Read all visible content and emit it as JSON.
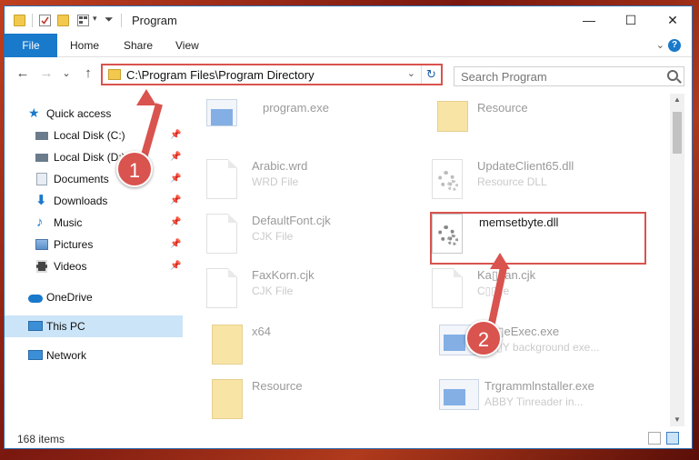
{
  "window": {
    "title": "Program",
    "minimize": "—",
    "maximize": "☐",
    "close": "✕"
  },
  "ribbon": {
    "tabs": [
      "File",
      "Home",
      "Share",
      "View"
    ],
    "collapse": "⌄",
    "help": "?"
  },
  "nav": {
    "back": "←",
    "forward": "→",
    "recent": "⌄",
    "up": "↑",
    "address": "C:\\Program Files\\Program Directory",
    "address_dropdown": "⌄",
    "refresh": "↻",
    "search_placeholder": "Search Program"
  },
  "sidebar": {
    "items": [
      {
        "label": "Quick access",
        "icon": "star-icon",
        "color": "#1979ca",
        "pinned": false
      },
      {
        "label": "Local Disk (C:)",
        "icon": "drive-icon",
        "color": "#6b7b8c",
        "pinned": true
      },
      {
        "label": "Local Disk (D:)",
        "icon": "drive-icon",
        "color": "#6b7b8c",
        "pinned": true
      },
      {
        "label": "Documents",
        "icon": "documents-icon",
        "color": "#9aa7b5",
        "pinned": true
      },
      {
        "label": "Downloads",
        "icon": "downloads-icon",
        "color": "#1979ca",
        "pinned": true
      },
      {
        "label": "Music",
        "icon": "music-icon",
        "color": "#1979ca",
        "pinned": true
      },
      {
        "label": "Pictures",
        "icon": "pictures-icon",
        "color": "#5b8fc7",
        "pinned": true
      },
      {
        "label": "Videos",
        "icon": "videos-icon",
        "color": "#444",
        "pinned": true
      },
      {
        "label": "OneDrive",
        "icon": "cloud-icon",
        "color": "#1979ca",
        "pinned": false
      },
      {
        "label": "This PC",
        "icon": "computer-icon",
        "color": "#3b8fd6",
        "pinned": false
      },
      {
        "label": "Network",
        "icon": "network-icon",
        "color": "#3b8fd6",
        "pinned": false
      }
    ],
    "pin_glyph": "📌"
  },
  "files": [
    {
      "name": "program.exe",
      "type": "",
      "icon": "exe"
    },
    {
      "name": "Resource",
      "type": "",
      "icon": "folder"
    },
    {
      "name": "Arabic.wrd",
      "type": "WRD File",
      "icon": "doc"
    },
    {
      "name": "UpdateClient65.dll",
      "type": "Resource DLL",
      "icon": "dll"
    },
    {
      "name": "DefaultFont.cjk",
      "type": "CJK File",
      "icon": "doc"
    },
    {
      "name": "memsetbyte.dll",
      "type": "",
      "icon": "dll"
    },
    {
      "name": "FaxKorn.cjk",
      "type": "CJK File",
      "icon": "doc"
    },
    {
      "name": "Ka▯▯an.cjk",
      "type": "C▯▯▯e",
      "icon": "doc"
    },
    {
      "name": "x64",
      "type": "",
      "icon": "folder"
    },
    {
      "name": "▯▯▯eExec.exe",
      "type": "▯▯▯Y background exe...",
      "icon": "exe"
    },
    {
      "name": "Resource",
      "type": "",
      "icon": "folder"
    },
    {
      "name": "Trgrammlnstaller.exe",
      "type": "ABBY Tinreader in...",
      "icon": "exe"
    }
  ],
  "status": {
    "items_count": "168 items"
  },
  "callouts": [
    "1",
    "2"
  ]
}
